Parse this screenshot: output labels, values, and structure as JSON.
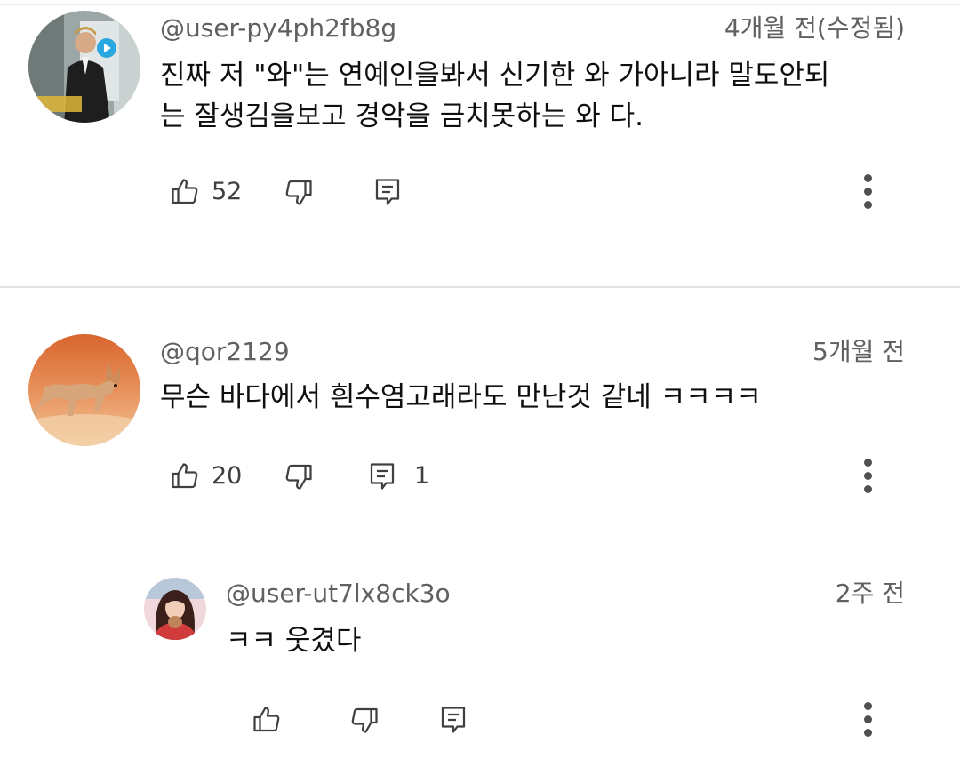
{
  "comments": [
    {
      "author": "@user-py4ph2fb8g",
      "time": "4개월 전(수정됨)",
      "text_lines": [
        "진짜 저 \"와\"는 연예인을봐서 신기한 와 가아니라 말도안되",
        "는 잘생김을보고 경악을 금치못하는 와 다."
      ],
      "likes": "52",
      "replies": "",
      "avatar_icon": "avatar-man-suit"
    },
    {
      "author": "@qor2129",
      "time": "5개월 전",
      "text_lines": [
        "무슨 바다에서 흰수염고래라도 만난것 같네 ㅋㅋㅋㅋ"
      ],
      "likes": "20",
      "replies": "1",
      "avatar_icon": "avatar-fennec-fox"
    }
  ],
  "reply": {
    "author": "@user-ut7lx8ck3o",
    "time": "2주 전",
    "text": "ㅋㅋ 웃겼다",
    "likes": "",
    "avatar_icon": "avatar-woman-cup"
  },
  "icons": {
    "like": "thumbs-up-icon",
    "dislike": "thumbs-down-icon",
    "reply": "reply-icon",
    "more": "more-vert-icon"
  },
  "colors": {
    "text": "#0f0f0f",
    "meta": "#606060",
    "divider": "#e2e2e2"
  }
}
